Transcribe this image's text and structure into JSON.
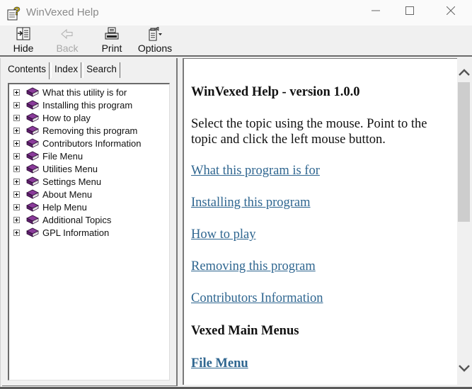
{
  "window": {
    "title": "WinVexed Help",
    "icon": "help-book-question-icon",
    "controls": {
      "minimize": "minimize-icon",
      "maximize": "maximize-icon",
      "close": "close-icon"
    }
  },
  "toolbar": {
    "buttons": [
      {
        "label": "Hide",
        "icon": "hide-pane-icon",
        "enabled": true
      },
      {
        "label": "Back",
        "icon": "back-arrow-icon",
        "enabled": false
      },
      {
        "label": "Print",
        "icon": "printer-icon",
        "enabled": true
      },
      {
        "label": "Options",
        "icon": "options-icon",
        "enabled": true
      }
    ]
  },
  "nav": {
    "tabs": [
      {
        "label": "Contents",
        "active": true
      },
      {
        "label": "Index",
        "active": false
      },
      {
        "label": "Search",
        "active": false
      }
    ],
    "tree": [
      {
        "label": "What this utility is for",
        "icon": "book-icon"
      },
      {
        "label": "Installing this program",
        "icon": "book-icon"
      },
      {
        "label": "How to play",
        "icon": "book-icon"
      },
      {
        "label": "Removing this program",
        "icon": "book-icon"
      },
      {
        "label": "Contributors Information",
        "icon": "book-icon"
      },
      {
        "label": "File Menu",
        "icon": "book-icon"
      },
      {
        "label": "Utilities Menu",
        "icon": "book-icon"
      },
      {
        "label": "Settings Menu",
        "icon": "book-icon"
      },
      {
        "label": "About Menu",
        "icon": "book-icon"
      },
      {
        "label": "Help Menu",
        "icon": "book-icon"
      },
      {
        "label": "Additional Topics",
        "icon": "book-icon"
      },
      {
        "label": "GPL Information",
        "icon": "book-icon"
      }
    ]
  },
  "content": {
    "title": "WinVexed Help - version 1.0.0",
    "intro": "Select the topic using the mouse. Point to the topic and click the left mouse button.",
    "links": [
      "What this program is for",
      "Installing this program",
      "How to play",
      "Removing this program",
      "Contributors Information"
    ],
    "section_heading": "Vexed Main Menus",
    "section_links": [
      "File Menu"
    ],
    "link_color": "#2f6690",
    "scroll_position": 0.0
  }
}
